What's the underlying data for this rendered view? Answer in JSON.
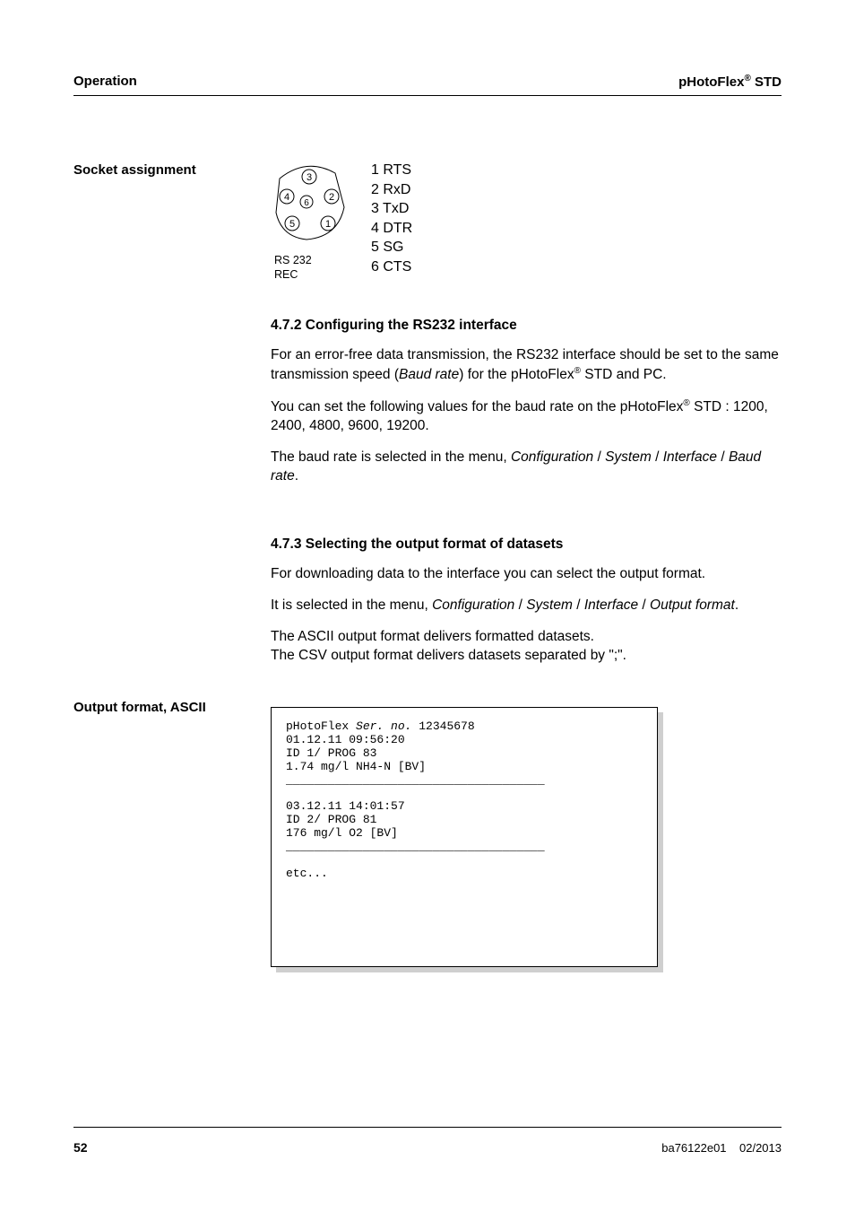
{
  "header": {
    "left": "Operation",
    "right_prefix": "pHotoFlex",
    "right_sup": "®",
    "right_suffix": " STD"
  },
  "socket": {
    "label": "Socket assignment",
    "pins": [
      "1 RTS",
      "2 RxD",
      "3 TxD",
      "4 DTR",
      "5 SG",
      "6 CTS"
    ],
    "port_line1": "RS 232",
    "port_line2": "REC",
    "circled": {
      "c1": "1",
      "c2": "2",
      "c3": "3",
      "c4": "4",
      "c5": "5",
      "c6": "6"
    }
  },
  "sec472": {
    "heading": "4.7.2   Configuring the RS232 interface",
    "p1_a": "For an error-free data transmission, the RS232 interface should be set to the same transmission speed (",
    "p1_b": "Baud rate",
    "p1_c": ") for the pHotoFlex",
    "p1_sup": "®",
    "p1_d": " STD and PC.",
    "p2_a": "You can set the following values for the baud rate on the pHotoFlex",
    "p2_sup": "®",
    "p2_b": " STD : 1200, 2400, 4800, 9600, 19200.",
    "p3_a": "The baud rate is selected in the menu, ",
    "p3_b": "Configuration",
    "p3_c": " / ",
    "p3_d": "System",
    "p3_e": " / ",
    "p3_f": "Interface",
    "p3_g": " / ",
    "p3_h": "Baud rate",
    "p3_i": "."
  },
  "sec473": {
    "heading": "4.7.3   Selecting the output format of datasets",
    "p1": "For downloading data to the interface you can select the output format.",
    "p2_a": "It is selected in the menu, ",
    "p2_b": "Configuration",
    "p2_c": " / ",
    "p2_d": "System",
    "p2_e": " / ",
    "p2_f": "Interface",
    "p2_g": " / ",
    "p2_h": "Output format",
    "p2_i": ".",
    "p3_l1": "The ASCII output format delivers formatted datasets.",
    "p3_l2": "The CSV output format delivers datasets separated by \";\"."
  },
  "ascii": {
    "label": "Output format, ASCII",
    "l1_a": "pHotoFlex ",
    "l1_b": "Ser. no.",
    "l1_c": " 12345678",
    "l2": "01.12.11 09:56:20",
    "l3": "ID 1/ PROG 83",
    "l4": "1.74 mg/l NH4-N [BV]",
    "sep": "_____________________________________",
    "l6": "03.12.11 14:01:57",
    "l7": "ID 2/ PROG 81",
    "l8": "176 mg/l O2 [BV]",
    "l10": "etc..."
  },
  "footer": {
    "page": "52",
    "doc": "ba76122e01",
    "date": "02/2013"
  }
}
